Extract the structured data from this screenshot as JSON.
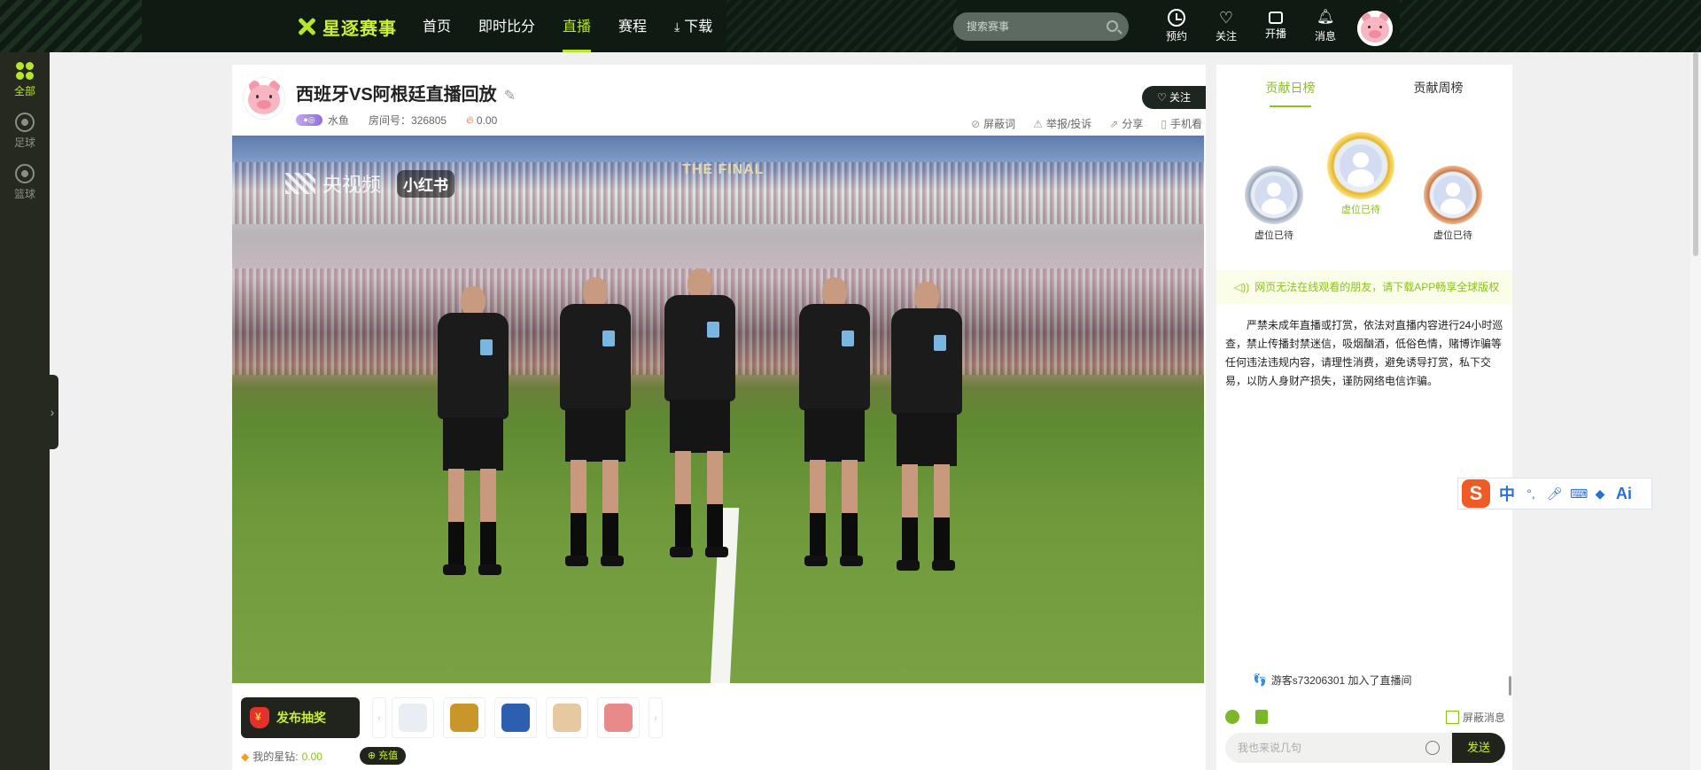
{
  "nav": {
    "logo_text": "星逐赛事",
    "items": [
      {
        "label": "首页"
      },
      {
        "label": "即时比分"
      },
      {
        "label": "直播"
      },
      {
        "label": "赛程"
      },
      {
        "label": "下载"
      }
    ],
    "active_index": 2,
    "search_placeholder": "搜索赛事",
    "actions": [
      {
        "label": "预约",
        "icon": "clock-icon"
      },
      {
        "label": "关注",
        "icon": "heart-icon"
      },
      {
        "label": "开播",
        "icon": "camera-icon"
      },
      {
        "label": "消息",
        "icon": "bell-icon"
      }
    ],
    "accent_color": "#b6e62a"
  },
  "sidebar": {
    "items": [
      {
        "label": "全部",
        "icon": "grid-icon",
        "active": true
      },
      {
        "label": "足球",
        "icon": "soccer-ball-icon",
        "active": false
      },
      {
        "label": "篮球",
        "icon": "basketball-icon",
        "active": false
      }
    ],
    "toggle": "›"
  },
  "room": {
    "title": "西班牙VS阿根廷直播回放",
    "anchor": "水鱼",
    "room_no_label": "房间号：",
    "room_no": "326805",
    "heat": "0.00",
    "follow_label": "关注",
    "tools": [
      {
        "label": "屏蔽词",
        "icon": "ban-icon"
      },
      {
        "label": "举报/投诉",
        "icon": "warning-icon"
      },
      {
        "label": "分享",
        "icon": "share-icon"
      },
      {
        "label": "手机看",
        "icon": "phone-icon"
      }
    ]
  },
  "video": {
    "overlay_watermark": "央视频",
    "overlay_badge": "小红书",
    "stadium_sign": "THE FINAL"
  },
  "gift_bar": {
    "lottery_label": "发布抽奖",
    "prev": "‹",
    "next": "›",
    "gifts": [
      {
        "icon": "trophy-gift-icon",
        "color": "#e9eef5"
      },
      {
        "icon": "card-gift-icon",
        "color": "#c9962a"
      },
      {
        "icon": "ticket-gift-icon",
        "color": "#2c5fb0"
      },
      {
        "icon": "boot-gift-icon",
        "color": "#e6c9a0"
      },
      {
        "icon": "player-gift-icon",
        "color": "#e88a8a"
      }
    ],
    "wallet_label": "我的星钻:",
    "wallet_value": "0.00",
    "recharge_label": "充值"
  },
  "right_panel": {
    "tabs": [
      {
        "label": "贡献日榜"
      },
      {
        "label": "贡献周榜"
      }
    ],
    "active_tab": 0,
    "medals": [
      {
        "rank": "silver",
        "label": "虚位已待"
      },
      {
        "rank": "gold",
        "label": "虚位已待"
      },
      {
        "rank": "bronze",
        "label": "虚位已待"
      }
    ],
    "notice": "网页无法在线观看的朋友，请下载APP畅享全球版权",
    "rules": "严禁未成年直播或打赏，依法对直播内容进行24小时巡查，禁止传播封禁迷信，吸烟酗酒，低俗色情，赌博诈骗等任何违法违规内容，请理性消费，避免诱导打赏，私下交易，以防人身财产损失，谨防网络电信诈骗。",
    "joined_text": "游客s73206301 加入了直播间",
    "shield_label": "屏蔽消息",
    "input_placeholder": "我也来说几句",
    "send_label": "发送"
  },
  "ime": {
    "logo": "S",
    "mode": "中",
    "punct": "°,",
    "ai": "Ai"
  }
}
